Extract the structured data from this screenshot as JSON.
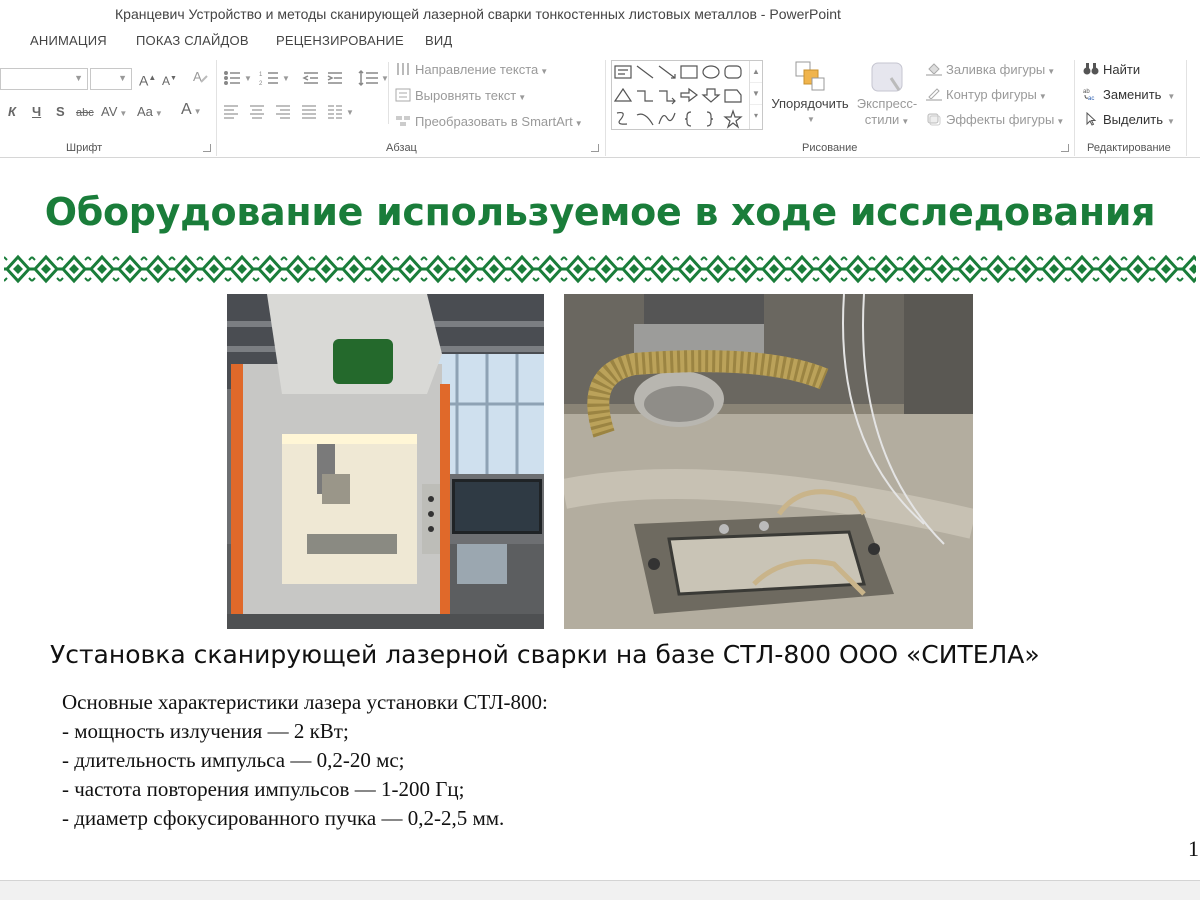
{
  "window": {
    "title": "Кранцевич Устройство и методы сканирующей лазерной сварки тонкостенных листовых металлов - PowerPoint"
  },
  "ribbon": {
    "tabs": [
      "АНИМАЦИЯ",
      "ПОКАЗ СЛАЙДОВ",
      "РЕЦЕНЗИРОВАНИЕ",
      "ВИД"
    ],
    "font_group": {
      "label": "Шрифт",
      "grow_font": "A",
      "shrink_font": "A",
      "bold": "К",
      "underline": "Ч",
      "shadow": "S",
      "strike": "abc",
      "spacing": "AV",
      "case": "Aa",
      "font_color": "A"
    },
    "paragraph_group": {
      "label": "Абзац",
      "text_direction": "Направление текста",
      "align_text": "Выровнять текст",
      "smartart": "Преобразовать в SmartArt"
    },
    "drawing_group": {
      "label": "Рисование",
      "arrange": "Упорядочить",
      "quick_styles_1": "Экспресс-",
      "quick_styles_2": "стили",
      "shape_fill": "Заливка фигуры",
      "shape_outline": "Контур фигуры",
      "shape_effects": "Эффекты фигуры"
    },
    "editing_group": {
      "label": "Редактирование",
      "find": "Найти",
      "replace": "Заменить",
      "select": "Выделить"
    }
  },
  "slide": {
    "title": "Оборудование используемое в ходе исследования",
    "caption": "Установка сканирующей лазерной сварки на базе СТЛ-800 ООО «СИТЕЛА»",
    "specs": [
      "Основные характеристики лазера установки СТЛ-800:",
      "- мощность излучения — 2 кВт;",
      "- длительность импульса — 0,2-20 мс;",
      "- частота повторения импульсов — 1-200 Гц;",
      "- диаметр сфокусированного пучка — 0,2-2,5 мм."
    ],
    "page_number": "1",
    "title_color": "#1a7d3a",
    "ornament_color": "#1a7d3a"
  }
}
